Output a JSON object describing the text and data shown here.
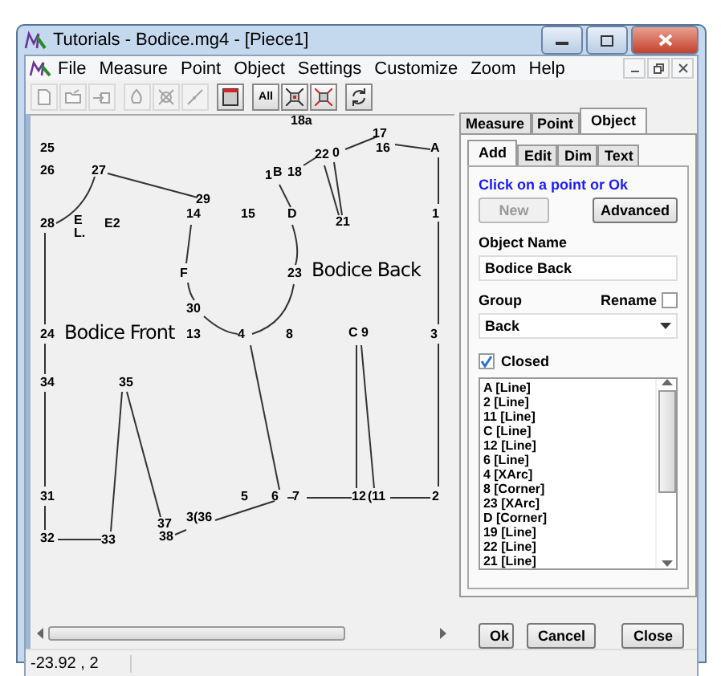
{
  "window": {
    "title": "Tutorials - Bodice.mg4 - [Piece1]"
  },
  "menu": [
    "File",
    "Measure",
    "Point",
    "Object",
    "Settings",
    "Customize",
    "Zoom",
    "Help"
  ],
  "toolbar": [
    [
      {
        "kind": "page",
        "disabled": true
      },
      {
        "kind": "folder",
        "disabled": true
      },
      {
        "kind": "import",
        "disabled": true
      }
    ],
    [
      {
        "kind": "shape",
        "disabled": true
      },
      {
        "kind": "cross",
        "disabled": true
      },
      {
        "kind": "line",
        "disabled": true
      }
    ],
    [
      {
        "kind": "window",
        "disabled": false
      }
    ],
    [
      {
        "kind": "text",
        "label": "All",
        "disabled": false
      },
      {
        "kind": "shrink",
        "disabled": false
      },
      {
        "kind": "expand",
        "disabled": false
      }
    ],
    [
      {
        "kind": "refresh",
        "disabled": false
      }
    ]
  ],
  "canvas": {
    "items": [
      {
        "kind": "point",
        "label": "18a"
      },
      {
        "kind": "point",
        "label": "17"
      },
      {
        "kind": "point",
        "label": "25"
      },
      {
        "kind": "point",
        "label": "22"
      },
      {
        "kind": "point",
        "label": "0"
      },
      {
        "kind": "point",
        "label": "16"
      },
      {
        "kind": "point",
        "label": "A"
      },
      {
        "kind": "point",
        "label": "26"
      },
      {
        "kind": "point",
        "label": "27"
      },
      {
        "kind": "point",
        "label": "1"
      },
      {
        "kind": "point",
        "label": "B"
      },
      {
        "kind": "point",
        "label": "18"
      },
      {
        "kind": "point",
        "label": "29"
      },
      {
        "kind": "point",
        "label": "28"
      },
      {
        "kind": "point",
        "label": "E"
      },
      {
        "kind": "point",
        "label": "E2"
      },
      {
        "kind": "point",
        "label": "14"
      },
      {
        "kind": "point",
        "label": "15"
      },
      {
        "kind": "point",
        "label": "D"
      },
      {
        "kind": "point",
        "label": "21"
      },
      {
        "kind": "point",
        "label": "1"
      },
      {
        "kind": "point",
        "label": "L."
      },
      {
        "kind": "point",
        "label": "F"
      },
      {
        "kind": "point",
        "label": "23"
      },
      {
        "kind": "piece",
        "label": "Bodice Back"
      },
      {
        "kind": "point",
        "label": "30"
      },
      {
        "kind": "point",
        "label": "24"
      },
      {
        "kind": "piece",
        "label": "Bodice Front"
      },
      {
        "kind": "point",
        "label": "13"
      },
      {
        "kind": "point",
        "label": "4"
      },
      {
        "kind": "point",
        "label": "8"
      },
      {
        "kind": "point",
        "label": "C 9"
      },
      {
        "kind": "point",
        "label": "3"
      },
      {
        "kind": "point",
        "label": "34"
      },
      {
        "kind": "point",
        "label": "35"
      },
      {
        "kind": "point",
        "label": "31"
      },
      {
        "kind": "point",
        "label": "5"
      },
      {
        "kind": "point",
        "label": "6"
      },
      {
        "kind": "point",
        "label": "7"
      },
      {
        "kind": "point",
        "label": "12"
      },
      {
        "kind": "point",
        "label": "(11"
      },
      {
        "kind": "point",
        "label": "2"
      },
      {
        "kind": "point",
        "label": "37"
      },
      {
        "kind": "point",
        "label": "3(36"
      },
      {
        "kind": "point",
        "label": "32"
      },
      {
        "kind": "point",
        "label": "33"
      },
      {
        "kind": "point",
        "label": "38"
      }
    ]
  },
  "side_tabs": [
    {
      "label": "Measure",
      "selected": false
    },
    {
      "label": "Point",
      "selected": false
    },
    {
      "label": "Object",
      "selected": true
    }
  ],
  "object_tabs": [
    {
      "label": "Add",
      "selected": true
    },
    {
      "label": "Edit",
      "selected": false
    },
    {
      "label": "Dim",
      "selected": false
    },
    {
      "label": "Text",
      "selected": false
    }
  ],
  "prompt": "Click on a point or Ok",
  "new_button": {
    "label": "New",
    "disabled": true
  },
  "advanced_button": {
    "label": "Advanced",
    "disabled": false
  },
  "object_name": {
    "label": "Object Name",
    "value": "Bodice Back"
  },
  "group": {
    "label": "Group",
    "value": "Back"
  },
  "rename": {
    "label": "Rename",
    "checked": false
  },
  "closed": {
    "label": "Closed",
    "checked": true
  },
  "segments": [
    {
      "label": "A [Line]",
      "selected": false
    },
    {
      "label": "2 [Line]",
      "selected": false
    },
    {
      "label": "11 [Line]",
      "selected": false
    },
    {
      "label": "C [Line]",
      "selected": false
    },
    {
      "label": "12 [Line]",
      "selected": false
    },
    {
      "label": "6 [Line]",
      "selected": false
    },
    {
      "label": "4 [XArc]",
      "selected": false
    },
    {
      "label": "8 [Corner]",
      "selected": false
    },
    {
      "label": "23 [XArc]",
      "selected": false
    },
    {
      "label": "D [Corner]",
      "selected": false
    },
    {
      "label": "19 [Line]",
      "selected": false
    },
    {
      "label": "22 [Line]",
      "selected": false
    },
    {
      "label": "21 [Line]",
      "selected": false
    }
  ],
  "buttons": [
    "Ok",
    "Cancel",
    "Close"
  ],
  "status_bar": {
    "coordinates": "-23.92 , 2"
  }
}
